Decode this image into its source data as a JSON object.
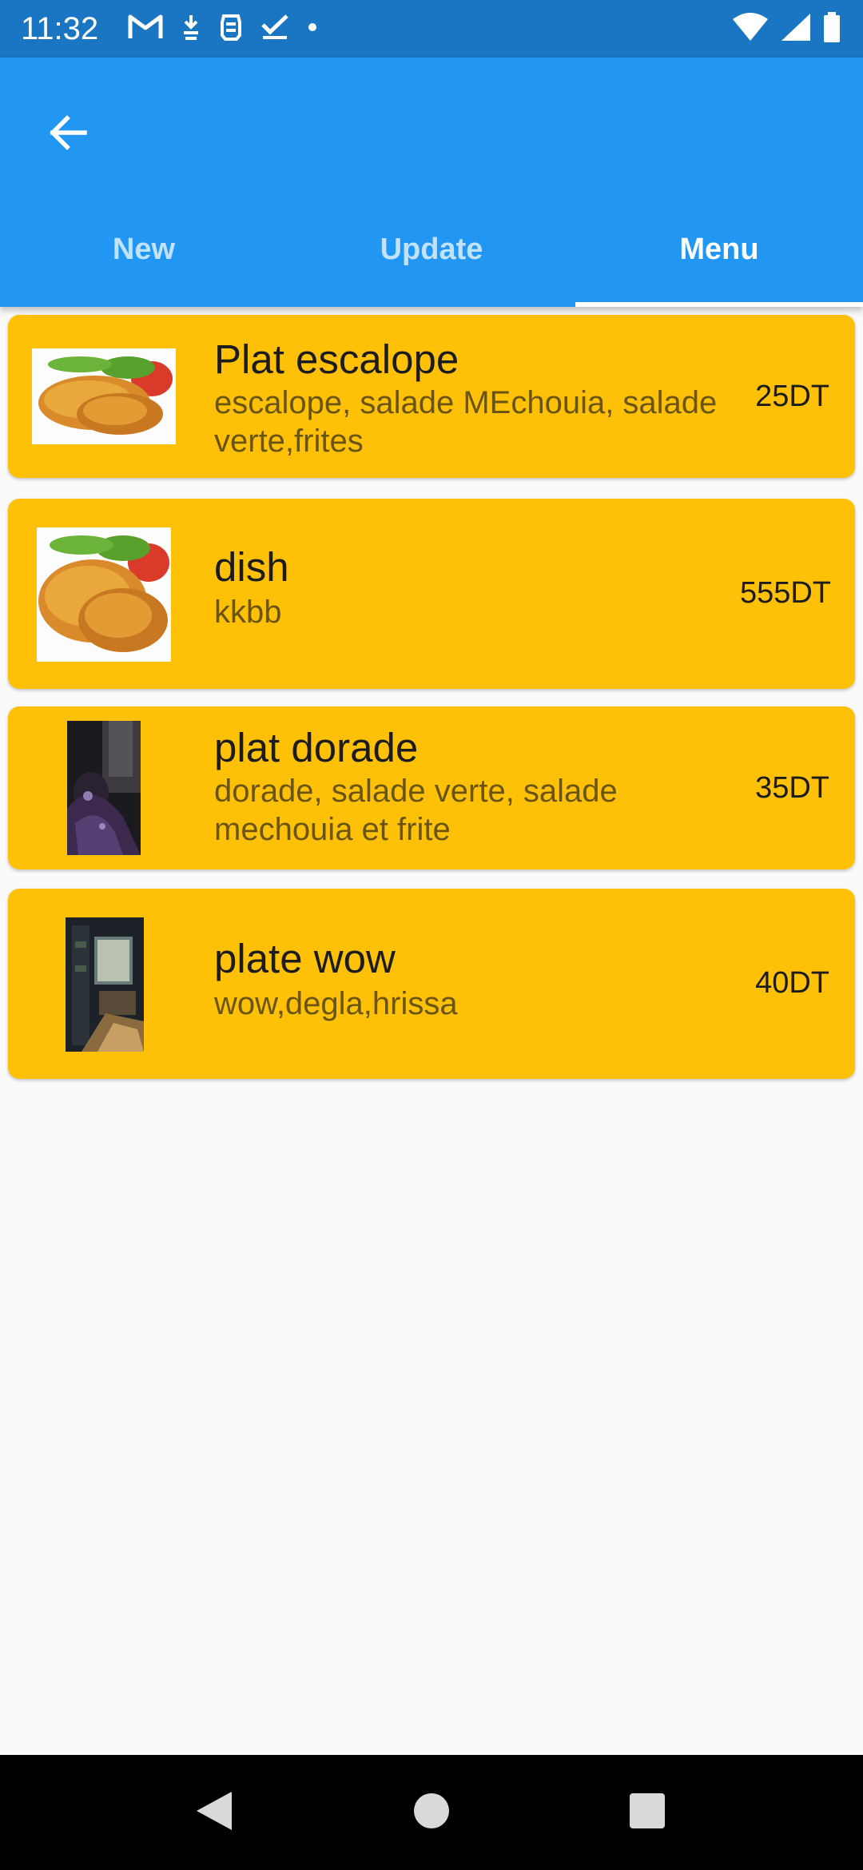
{
  "status_bar": {
    "time": "11:32",
    "left_icons": [
      "gmail-icon",
      "download-icon",
      "security-icon",
      "check-icon",
      "dot-icon"
    ],
    "right_icons": [
      "wifi-icon",
      "signal-icon",
      "battery-icon"
    ]
  },
  "app_bar": {
    "back_icon": "arrow-back-icon",
    "color": "#2196f3"
  },
  "tabs": [
    {
      "label": "New",
      "active": false
    },
    {
      "label": "Update",
      "active": false
    },
    {
      "label": "Menu",
      "active": true
    }
  ],
  "menu_items": [
    {
      "name": "Plat escalope",
      "description": "escalope, salade MEchouia, salade verte,frites",
      "price": "25DT",
      "image": "escalope-photo"
    },
    {
      "name": "dish",
      "description": "kkbb",
      "price": "555DT",
      "image": "escalope-photo"
    },
    {
      "name": "plat dorade",
      "description": "dorade, salade verte, salade mechouia et frite",
      "price": "35DT",
      "image": "dark-photo"
    },
    {
      "name": "plate wow",
      "description": "wow,degla,hrissa",
      "price": "40DT",
      "image": "room-photo"
    }
  ],
  "colors": {
    "status_bar": "#1a75c2",
    "card": "#ffc107",
    "background": "#fafafa"
  },
  "nav_bar": {
    "icons": [
      "nav-back-icon",
      "nav-home-icon",
      "nav-recents-icon"
    ]
  }
}
